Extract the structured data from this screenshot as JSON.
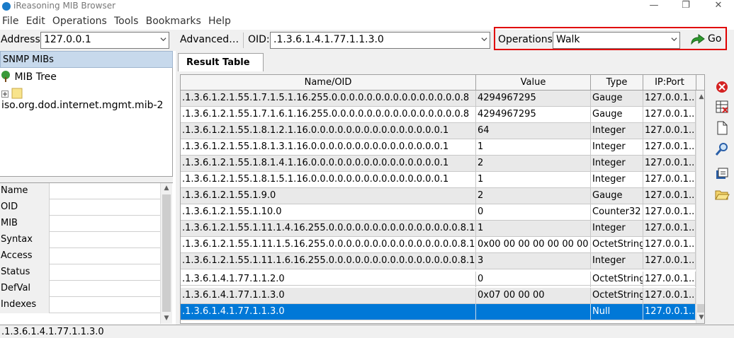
{
  "window": {
    "title": "iReasoning MIB Browser",
    "minimize": "—",
    "maximize": "❐",
    "close": "✕"
  },
  "menu": [
    "File",
    "Edit",
    "Operations",
    "Tools",
    "Bookmarks",
    "Help"
  ],
  "toolbar": {
    "address_label": "Address:",
    "address_value": "127.0.0.1",
    "advanced_label": "Advanced…",
    "oid_label": "OID:",
    "oid_value": ".1.3.6.1.4.1.77.1.1.3.0",
    "operations_label": "Operations:",
    "operations_value": "Walk",
    "go_label": "Go"
  },
  "left": {
    "header": "SNMP MIBs",
    "tree_root": "MIB Tree",
    "tree_child": "iso.org.dod.internet.mgmt.mib-2",
    "properties": [
      "Name",
      "OID",
      "MIB",
      "Syntax",
      "Access",
      "Status",
      "DefVal",
      "Indexes"
    ]
  },
  "result": {
    "tab": "Result Table",
    "columns": [
      "Name/OID",
      "Value",
      "Type",
      "IP:Port"
    ],
    "rows": [
      [
        ".1.3.6.1.2.1.55.1.7.1.5.1.16.255.0.0.0.0.0.0.0.0.0.0.0.0.0.0.0.8",
        "4294967295",
        "Gauge",
        "127.0.0.1..."
      ],
      [
        ".1.3.6.1.2.1.55.1.7.1.6.1.16.255.0.0.0.0.0.0.0.0.0.0.0.0.0.0.0.8",
        "4294967295",
        "Gauge",
        "127.0.0.1..."
      ],
      [
        ".1.3.6.1.2.1.55.1.8.1.2.1.16.0.0.0.0.0.0.0.0.0.0.0.0.0.0.0.1",
        "64",
        "Integer",
        "127.0.0.1..."
      ],
      [
        ".1.3.6.1.2.1.55.1.8.1.3.1.16.0.0.0.0.0.0.0.0.0.0.0.0.0.0.0.1",
        "1",
        "Integer",
        "127.0.0.1..."
      ],
      [
        ".1.3.6.1.2.1.55.1.8.1.4.1.16.0.0.0.0.0.0.0.0.0.0.0.0.0.0.0.1",
        "2",
        "Integer",
        "127.0.0.1..."
      ],
      [
        ".1.3.6.1.2.1.55.1.8.1.5.1.16.0.0.0.0.0.0.0.0.0.0.0.0.0.0.0.1",
        "1",
        "Integer",
        "127.0.0.1..."
      ],
      [
        ".1.3.6.1.2.1.55.1.9.0",
        "2",
        "Gauge",
        "127.0.0.1..."
      ],
      [
        ".1.3.6.1.2.1.55.1.10.0",
        "0",
        "Counter32",
        "127.0.0.1..."
      ],
      [
        ".1.3.6.1.2.1.55.1.11.1.4.16.255.0.0.0.0.0.0.0.0.0.0.0.0.0.0.0.8.1",
        "1",
        "Integer",
        "127.0.0.1..."
      ],
      [
        ".1.3.6.1.2.1.55.1.11.1.5.16.255.0.0.0.0.0.0.0.0.0.0.0.0.0.0.0.8.1",
        "0x00 00 00 00 00 00 00",
        "OctetString",
        "127.0.0.1..."
      ],
      [
        ".1.3.6.1.2.1.55.1.11.1.6.16.255.0.0.0.0.0.0.0.0.0.0.0.0.0.0.0.8.1",
        "3",
        "Integer",
        "127.0.0.1..."
      ],
      [
        ".1.3.6.1.4.1.77.1.1.2.0",
        "0",
        "OctetString",
        "127.0.0.1..."
      ],
      [
        ".1.3.6.1.4.1.77.1.1.3.0",
        "0x07 00 00 00",
        "OctetString",
        "127.0.0.1..."
      ],
      [
        ".1.3.6.1.4.1.77.1.1.3.0",
        "",
        "Null",
        "127.0.0.1..."
      ]
    ],
    "selected_row": 13
  },
  "side_tools": [
    "delete-icon",
    "clear-table-icon",
    "document-icon",
    "find-icon",
    "export-icon",
    "open-folder-icon"
  ],
  "status": ".1.3.6.1.4.1.77.1.1.3.0"
}
